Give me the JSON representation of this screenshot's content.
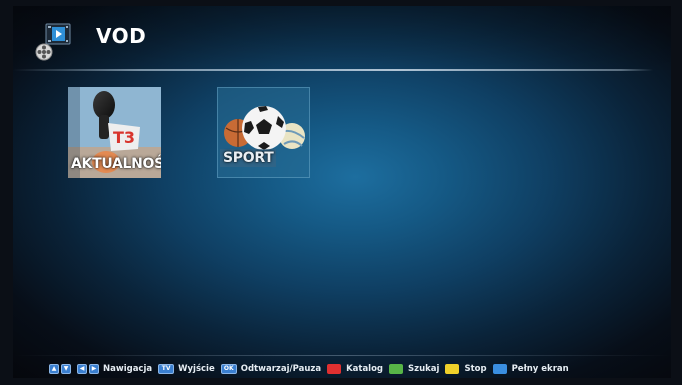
{
  "header": {
    "title": "VOD",
    "logo_icon": "film-reel-play-icon"
  },
  "tiles": [
    {
      "label": "AKTUALNOŚCI",
      "icon": "microphone-news-icon"
    },
    {
      "label": "SPORT",
      "icon": "sport-balls-icon"
    }
  ],
  "footer": {
    "navigation_label": "Nawigacja",
    "exit_key": "TV",
    "exit_label": "Wyjście",
    "play_key": "OK",
    "play_label": "Odtwarzaj/Pauza",
    "catalog_label": "Katalog",
    "search_label": "Szukaj",
    "stop_label": "Stop",
    "fullscreen_label": "Pełny ekran"
  },
  "colors": {
    "red": "#e03030",
    "green": "#57b547",
    "yellow": "#f0d12a",
    "blue": "#3a8ee0"
  }
}
